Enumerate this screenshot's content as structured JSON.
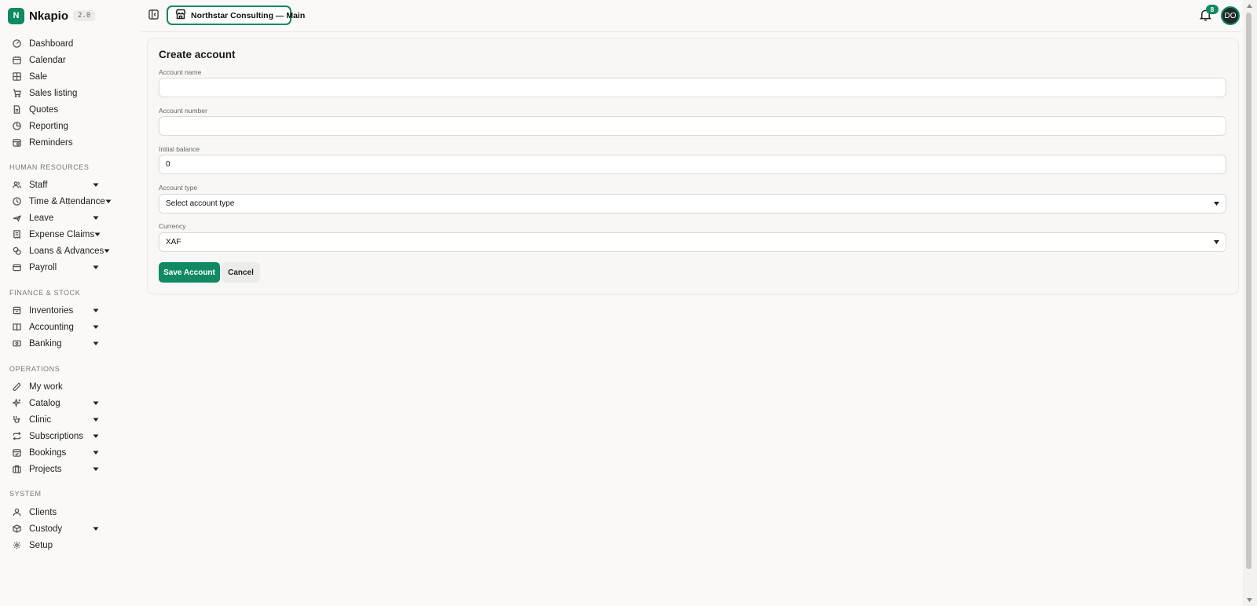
{
  "brand": {
    "logo_letter": "N",
    "name": "Nkapio",
    "version": "2.0"
  },
  "colors": {
    "accent": "#118a63",
    "background": "#faf9f7"
  },
  "sidebar": {
    "main": [
      {
        "label": "Dashboard",
        "icon": "dashboard-icon"
      },
      {
        "label": "Calendar",
        "icon": "calendar-icon"
      },
      {
        "label": "Sale",
        "icon": "grid-icon"
      },
      {
        "label": "Sales listing",
        "icon": "cart-icon"
      },
      {
        "label": "Quotes",
        "icon": "document-icon"
      },
      {
        "label": "Reporting",
        "icon": "pie-chart-icon"
      },
      {
        "label": "Reminders",
        "icon": "calendar-clock-icon"
      }
    ],
    "sections": [
      {
        "title": "HUMAN RESOURCES",
        "items": [
          {
            "label": "Staff",
            "icon": "users-icon"
          },
          {
            "label": "Time & Attendance",
            "icon": "clock-icon"
          },
          {
            "label": "Leave",
            "icon": "plane-icon"
          },
          {
            "label": "Expense Claims",
            "icon": "receipt-icon"
          },
          {
            "label": "Loans & Advances",
            "icon": "coins-icon"
          },
          {
            "label": "Payroll",
            "icon": "wallet-icon"
          }
        ]
      },
      {
        "title": "FINANCE & STOCK",
        "items": [
          {
            "label": "Inventories",
            "icon": "box-icon"
          },
          {
            "label": "Accounting",
            "icon": "book-icon"
          },
          {
            "label": "Banking",
            "icon": "bank-card-icon"
          }
        ]
      },
      {
        "title": "OPERATIONS",
        "items": [
          {
            "label": "My work",
            "icon": "wrench-icon"
          },
          {
            "label": "Catalog",
            "icon": "sparkles-icon"
          },
          {
            "label": "Clinic",
            "icon": "stethoscope-icon"
          },
          {
            "label": "Subscriptions",
            "icon": "repeat-icon"
          },
          {
            "label": "Bookings",
            "icon": "calendar-check-icon"
          },
          {
            "label": "Projects",
            "icon": "briefcase-icon"
          }
        ]
      },
      {
        "title": "SYSTEM",
        "items": [
          {
            "label": "Clients",
            "icon": "user-icon"
          },
          {
            "label": "Custody",
            "icon": "package-icon"
          },
          {
            "label": "Setup",
            "icon": "gear-icon"
          }
        ]
      }
    ]
  },
  "topbar": {
    "store_name": "Northstar Consulting — Main",
    "notification_count": "8",
    "avatar_initials": "DO"
  },
  "form": {
    "title": "Create account",
    "account_name": {
      "label": "Account name",
      "value": ""
    },
    "account_number": {
      "label": "Account number",
      "value": ""
    },
    "initial_balance": {
      "label": "Initial balance",
      "value": "0"
    },
    "account_type": {
      "label": "Account type",
      "value": "Select account type"
    },
    "currency": {
      "label": "Currency",
      "value": "XAF"
    },
    "save_label": "Save Account",
    "cancel_label": "Cancel"
  }
}
